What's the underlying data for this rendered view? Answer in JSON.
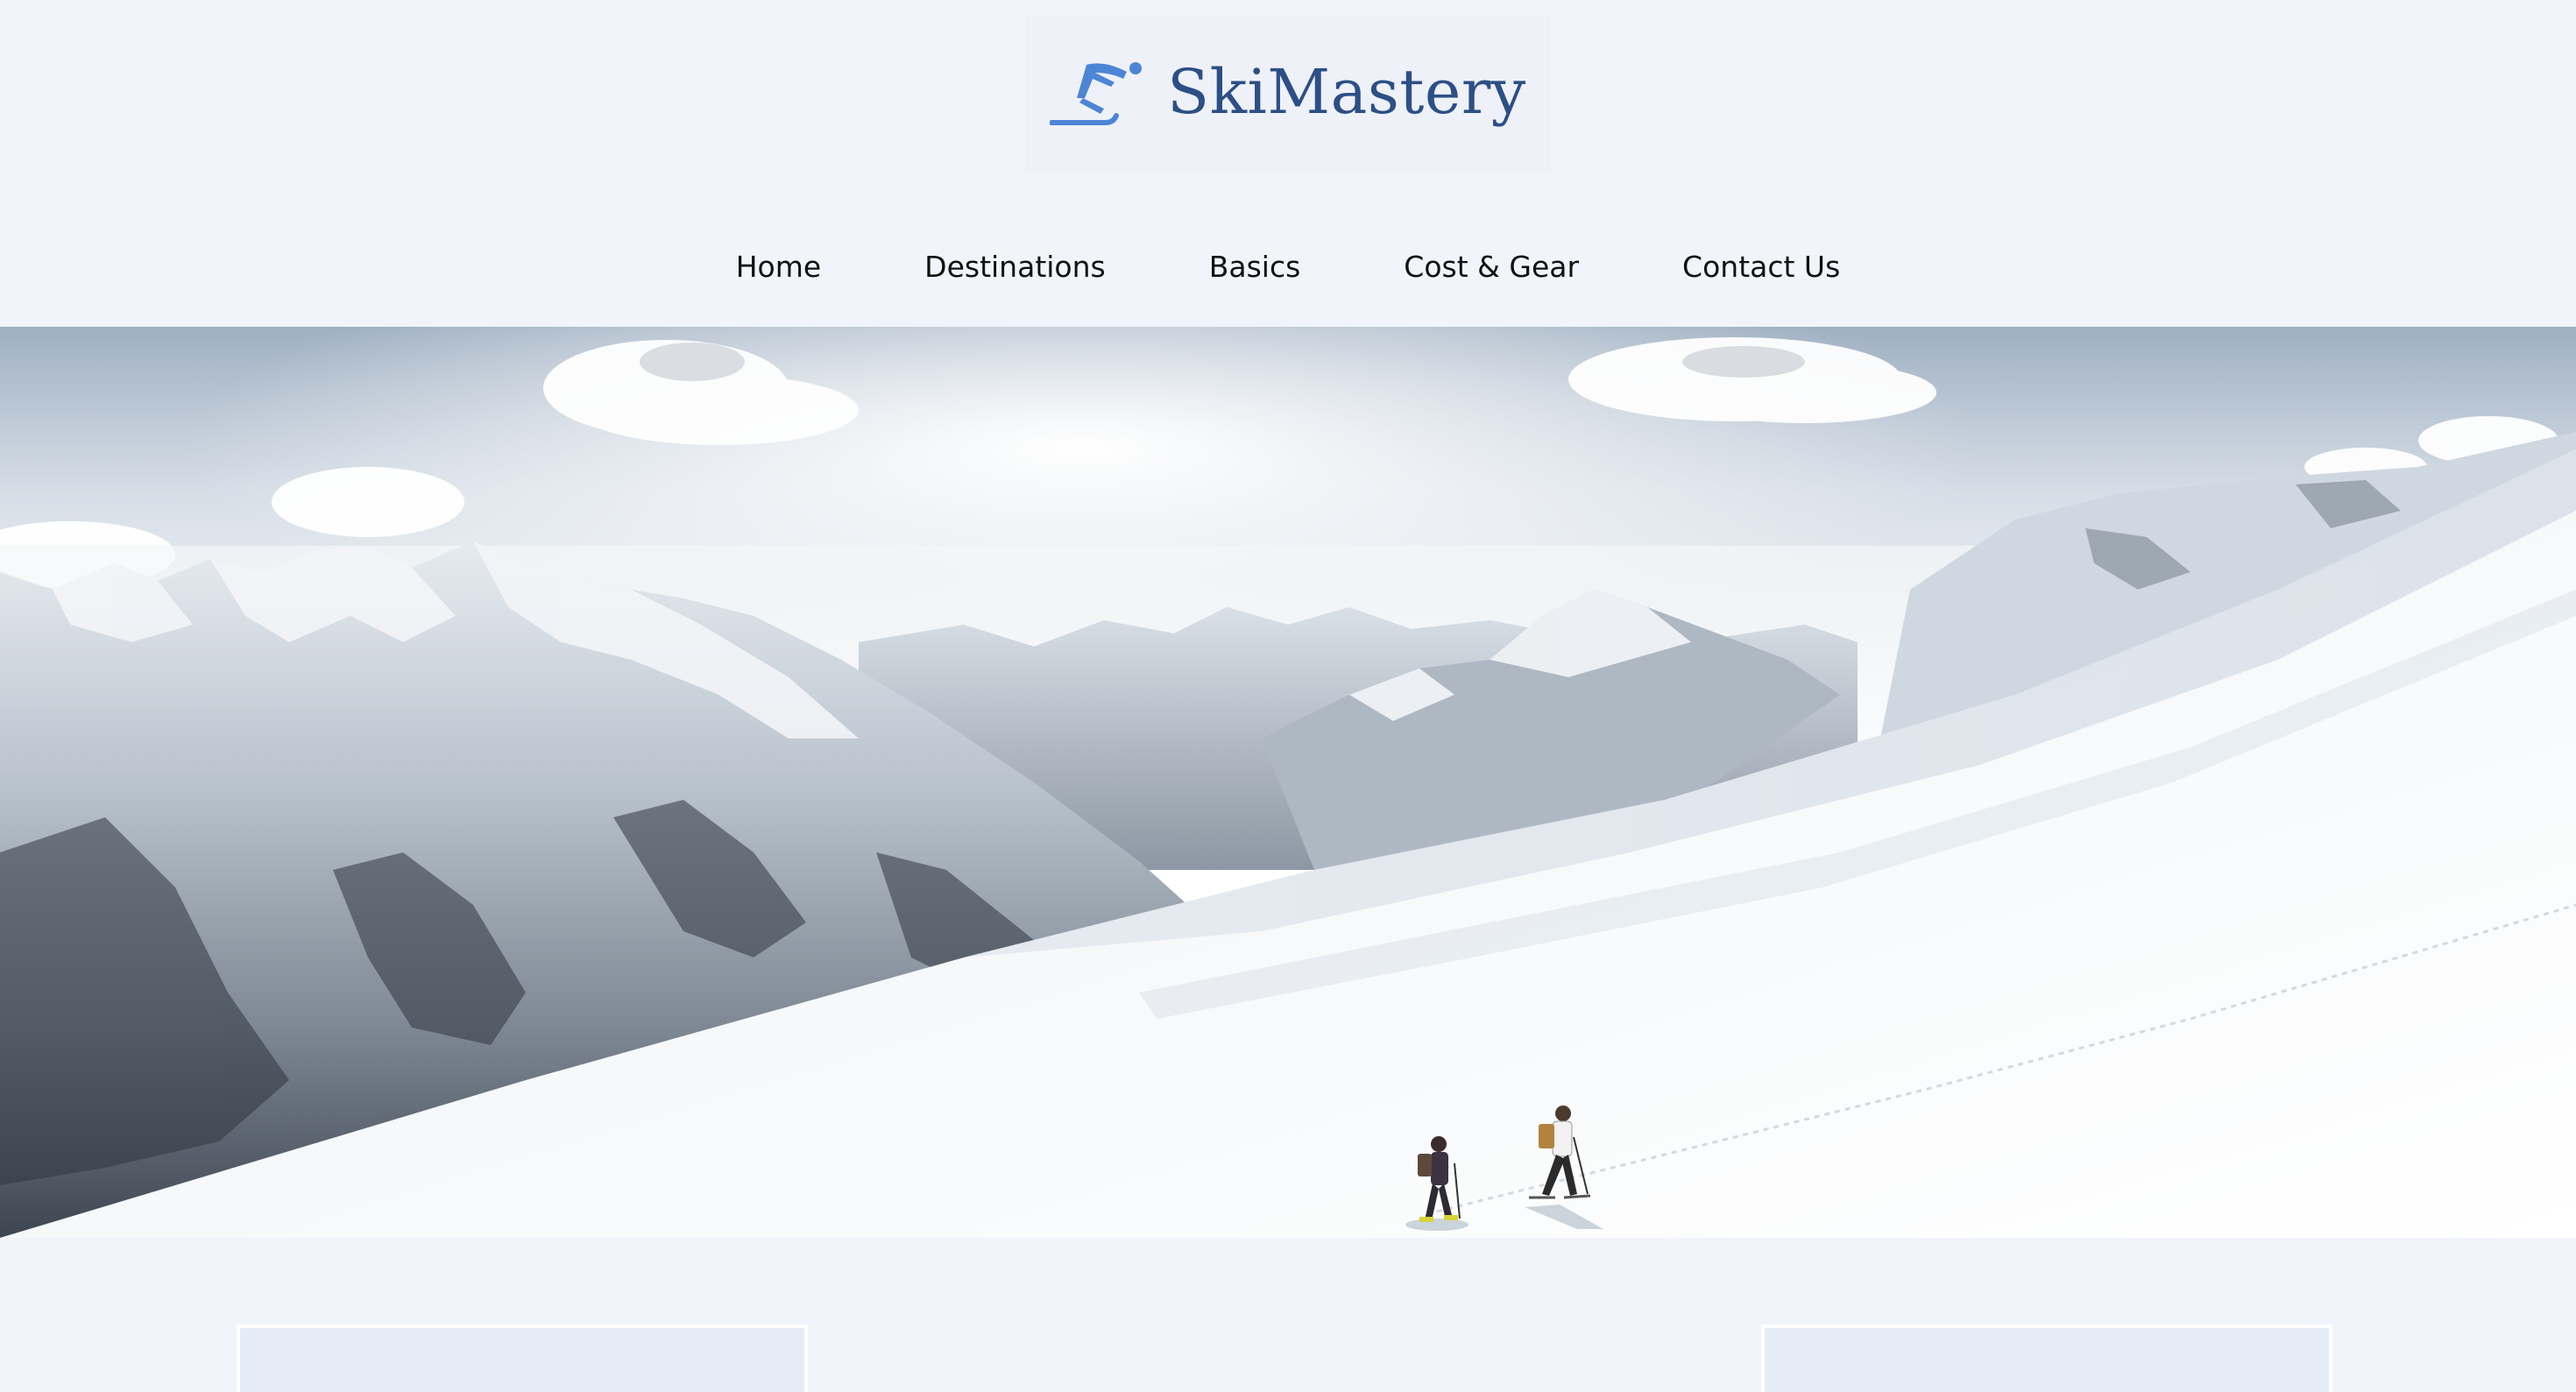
{
  "brand": {
    "name": "SkiMastery",
    "icon": "ski-jumper-icon",
    "color": "#2c4f86",
    "icon_color": "#4d85d6"
  },
  "nav": {
    "items": [
      {
        "label": "Home"
      },
      {
        "label": "Destinations"
      },
      {
        "label": "Basics"
      },
      {
        "label": "Cost & Gear"
      },
      {
        "label": "Contact Us"
      }
    ]
  },
  "hero": {
    "image": "snowy-mountain-range-with-two-ski-tourers"
  },
  "colors": {
    "page_background": "#f2f4fb",
    "card_background": "#e5ecf8"
  }
}
